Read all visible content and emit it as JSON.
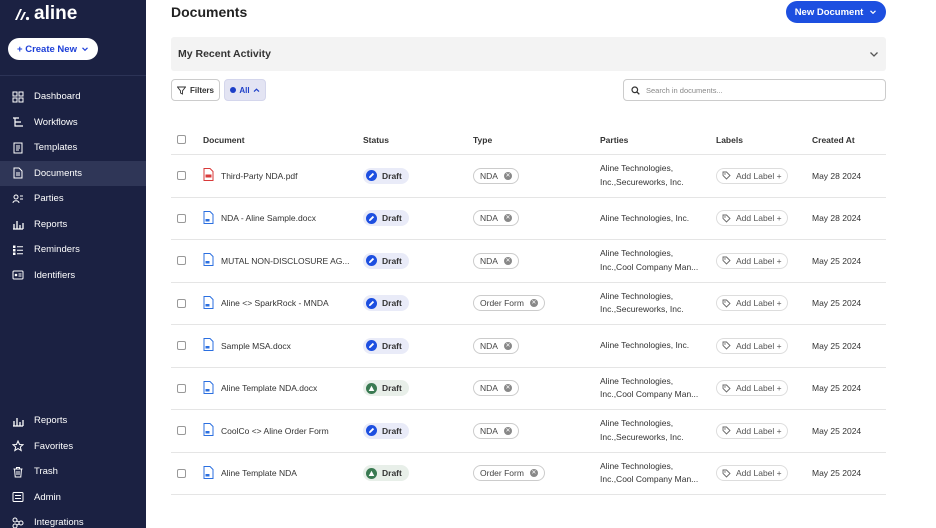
{
  "app": {
    "logo_text": "aline"
  },
  "sidebar": {
    "create_label": "+ Create New",
    "top_items": [
      {
        "label": "Dashboard",
        "icon": "dashboard-icon"
      },
      {
        "label": "Workflows",
        "icon": "workflow-icon"
      },
      {
        "label": "Templates",
        "icon": "template-icon"
      },
      {
        "label": "Documents",
        "icon": "document-icon",
        "active": true
      },
      {
        "label": "Parties",
        "icon": "parties-icon"
      },
      {
        "label": "Reports",
        "icon": "reports-icon"
      },
      {
        "label": "Reminders",
        "icon": "reminders-icon"
      },
      {
        "label": "Identifiers",
        "icon": "identifiers-icon"
      }
    ],
    "bottom_items": [
      {
        "label": "Reports",
        "icon": "reports-icon"
      },
      {
        "label": "Favorites",
        "icon": "star-icon"
      },
      {
        "label": "Trash",
        "icon": "trash-icon"
      },
      {
        "label": "Admin",
        "icon": "admin-icon"
      },
      {
        "label": "Integrations",
        "icon": "integrations-icon"
      }
    ]
  },
  "header": {
    "title": "Documents",
    "new_doc_label": "New Document"
  },
  "activity": {
    "title": "My Recent Activity"
  },
  "toolbar": {
    "filters_label": "Filters",
    "all_label": "All",
    "search_placeholder": "Search in documents..."
  },
  "table": {
    "columns": {
      "document": "Document",
      "status": "Status",
      "type": "Type",
      "parties": "Parties",
      "labels": "Labels",
      "created": "Created At"
    },
    "rows": [
      {
        "name": "Third-Party NDA.pdf",
        "file": "pdf",
        "status": "Draft",
        "status_color": "blue",
        "type": "NDA",
        "parties": "Aline Technologies,\nInc.,Secureworks, Inc.",
        "label": "Add Label +",
        "created": "May 28 2024"
      },
      {
        "name": "NDA - Aline Sample.docx",
        "file": "doc",
        "status": "Draft",
        "status_color": "blue",
        "type": "NDA",
        "parties": "Aline Technologies, Inc.",
        "label": "Add Label +",
        "created": "May 28 2024"
      },
      {
        "name": "MUTAL NON-DISCLOSURE AG...",
        "file": "doc",
        "status": "Draft",
        "status_color": "blue",
        "type": "NDA",
        "parties": "Aline Technologies,\nInc.,Cool Company Man...",
        "label": "Add Label +",
        "created": "May 25 2024"
      },
      {
        "name": "Aline <> SparkRock - MNDA",
        "file": "doc",
        "status": "Draft",
        "status_color": "blue",
        "type": "Order Form",
        "parties": "Aline Technologies,\nInc.,Secureworks, Inc.",
        "label": "Add Label +",
        "created": "May 25 2024"
      },
      {
        "name": "Sample MSA.docx",
        "file": "doc",
        "status": "Draft",
        "status_color": "blue",
        "type": "NDA",
        "parties": "Aline Technologies, Inc.",
        "label": "Add Label +",
        "created": "May 25 2024"
      },
      {
        "name": "Aline Template NDA.docx",
        "file": "doc",
        "status": "Draft",
        "status_color": "green",
        "type": "NDA",
        "parties": "Aline Technologies,\nInc.,Cool Company Man...",
        "label": "Add Label +",
        "created": "May 25 2024"
      },
      {
        "name": "CoolCo <> Aline Order Form",
        "file": "doc",
        "status": "Draft",
        "status_color": "blue",
        "type": "NDA",
        "parties": "Aline Technologies,\nInc.,Secureworks, Inc.",
        "label": "Add Label +",
        "created": "May 25 2024"
      },
      {
        "name": "Aline Template NDA",
        "file": "doc",
        "status": "Draft",
        "status_color": "green",
        "type": "Order Form",
        "parties": "Aline Technologies,\nInc.,Cool Company Man...",
        "label": "Add Label +",
        "created": "May 25 2024"
      }
    ]
  },
  "colors": {
    "sidebar_bg": "#1b2142",
    "accent": "#1d4fe0",
    "pdf_red": "#d83a3a",
    "draft_green": "#3a7a52"
  }
}
